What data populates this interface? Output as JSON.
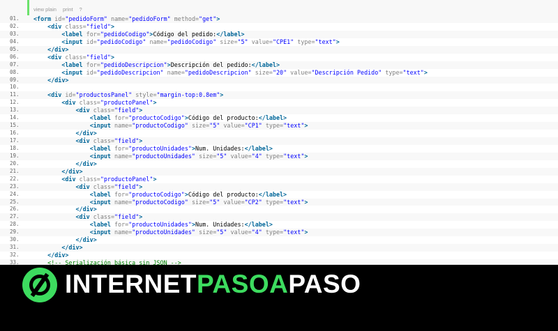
{
  "toolbar": {
    "view_plain": "view plain",
    "print": "print",
    "help": "?"
  },
  "code_lines": [
    {
      "n": "01.",
      "html": "<span class=\"tag\">&lt;form</span> <span class=\"attr\">id=</span><span class=\"val\">\"pedidoForm\"</span> <span class=\"attr\">name=</span><span class=\"val\">\"pedidoForm\"</span> <span class=\"attr\">method=</span><span class=\"val\">\"get\"</span><span class=\"tag\">&gt;</span>"
    },
    {
      "n": "02.",
      "html": "    <span class=\"tag\">&lt;div</span> <span class=\"attr\">class=</span><span class=\"val\">\"field\"</span><span class=\"tag\">&gt;</span>"
    },
    {
      "n": "03.",
      "html": "        <span class=\"tag\">&lt;label</span> <span class=\"attr\">for=</span><span class=\"val\">\"pedidoCodigo\"</span><span class=\"tag\">&gt;</span>Código del pedido:<span class=\"tag\">&lt;/label&gt;</span>"
    },
    {
      "n": "04.",
      "html": "        <span class=\"tag\">&lt;input</span> <span class=\"attr\">id=</span><span class=\"val\">\"pedidoCodigo\"</span> <span class=\"attr\">name=</span><span class=\"val\">\"pedidoCodigo\"</span> <span class=\"attr\">size=</span><span class=\"val\">\"5\"</span> <span class=\"attr\">value=</span><span class=\"val\">\"CPE1\"</span> <span class=\"attr\">type=</span><span class=\"val\">\"text\"</span><span class=\"tag\">&gt;</span>"
    },
    {
      "n": "05.",
      "html": "    <span class=\"tag\">&lt;/div&gt;</span>"
    },
    {
      "n": "06.",
      "html": "    <span class=\"tag\">&lt;div</span> <span class=\"attr\">class=</span><span class=\"val\">\"field\"</span><span class=\"tag\">&gt;</span>"
    },
    {
      "n": "07.",
      "html": "        <span class=\"tag\">&lt;label</span> <span class=\"attr\">for=</span><span class=\"val\">\"pedidoDescripcion\"</span><span class=\"tag\">&gt;</span>Descripción del pedido:<span class=\"tag\">&lt;/label&gt;</span>"
    },
    {
      "n": "08.",
      "html": "        <span class=\"tag\">&lt;input</span> <span class=\"attr\">id=</span><span class=\"val\">\"pedidoDescripcion\"</span> <span class=\"attr\">name=</span><span class=\"val\">\"pedidoDescripcion\"</span> <span class=\"attr\">size=</span><span class=\"val\">\"20\"</span> <span class=\"attr\">value=</span><span class=\"val\">\"Descripción Pedido\"</span> <span class=\"attr\">type=</span><span class=\"val\">\"text\"</span><span class=\"tag\">&gt;</span>"
    },
    {
      "n": "09.",
      "html": "    <span class=\"tag\">&lt;/div&gt;</span>"
    },
    {
      "n": "10.",
      "html": ""
    },
    {
      "n": "11.",
      "html": "    <span class=\"tag\">&lt;div</span> <span class=\"attr\">id=</span><span class=\"val\">\"productosPanel\"</span> <span class=\"attr\">style=</span><span class=\"val\">\"margin-top:0.8em\"</span><span class=\"tag\">&gt;</span>"
    },
    {
      "n": "12.",
      "html": "        <span class=\"tag\">&lt;div</span> <span class=\"attr\">class=</span><span class=\"val\">\"productoPanel\"</span><span class=\"tag\">&gt;</span>"
    },
    {
      "n": "13.",
      "html": "            <span class=\"tag\">&lt;div</span> <span class=\"attr\">class=</span><span class=\"val\">\"field\"</span><span class=\"tag\">&gt;</span>"
    },
    {
      "n": "14.",
      "html": "                <span class=\"tag\">&lt;label</span> <span class=\"attr\">for=</span><span class=\"val\">\"productoCodigo\"</span><span class=\"tag\">&gt;</span>Código del producto:<span class=\"tag\">&lt;/label&gt;</span>"
    },
    {
      "n": "15.",
      "html": "                <span class=\"tag\">&lt;input</span> <span class=\"attr\">name=</span><span class=\"val\">\"productoCodigo\"</span> <span class=\"attr\">size=</span><span class=\"val\">\"5\"</span> <span class=\"attr\">value=</span><span class=\"val\">\"CP1\"</span> <span class=\"attr\">type=</span><span class=\"val\">\"text\"</span><span class=\"tag\">&gt;</span>"
    },
    {
      "n": "16.",
      "html": "            <span class=\"tag\">&lt;/div&gt;</span>"
    },
    {
      "n": "17.",
      "html": "            <span class=\"tag\">&lt;div</span> <span class=\"attr\">class=</span><span class=\"val\">\"field\"</span><span class=\"tag\">&gt;</span>"
    },
    {
      "n": "18.",
      "html": "                <span class=\"tag\">&lt;label</span> <span class=\"attr\">for=</span><span class=\"val\">\"productoUnidades\"</span><span class=\"tag\">&gt;</span>Num. Unidades:<span class=\"tag\">&lt;/label&gt;</span>"
    },
    {
      "n": "19.",
      "html": "                <span class=\"tag\">&lt;input</span> <span class=\"attr\">name=</span><span class=\"val\">\"productoUnidades\"</span> <span class=\"attr\">size=</span><span class=\"val\">\"5\"</span> <span class=\"attr\">value=</span><span class=\"val\">\"4\"</span> <span class=\"attr\">type=</span><span class=\"val\">\"text\"</span><span class=\"tag\">&gt;</span>"
    },
    {
      "n": "20.",
      "html": "            <span class=\"tag\">&lt;/div&gt;</span>"
    },
    {
      "n": "21.",
      "html": "        <span class=\"tag\">&lt;/div&gt;</span>"
    },
    {
      "n": "22.",
      "html": "        <span class=\"tag\">&lt;div</span> <span class=\"attr\">class=</span><span class=\"val\">\"productoPanel\"</span><span class=\"tag\">&gt;</span>"
    },
    {
      "n": "23.",
      "html": "            <span class=\"tag\">&lt;div</span> <span class=\"attr\">class=</span><span class=\"val\">\"field\"</span><span class=\"tag\">&gt;</span>"
    },
    {
      "n": "24.",
      "html": "                <span class=\"tag\">&lt;label</span> <span class=\"attr\">for=</span><span class=\"val\">\"productoCodigo\"</span><span class=\"tag\">&gt;</span>Código del producto:<span class=\"tag\">&lt;/label&gt;</span>"
    },
    {
      "n": "25.",
      "html": "                <span class=\"tag\">&lt;input</span> <span class=\"attr\">name=</span><span class=\"val\">\"productoCodigo\"</span> <span class=\"attr\">size=</span><span class=\"val\">\"5\"</span> <span class=\"attr\">value=</span><span class=\"val\">\"CP2\"</span> <span class=\"attr\">type=</span><span class=\"val\">\"text\"</span><span class=\"tag\">&gt;</span>"
    },
    {
      "n": "26.",
      "html": "            <span class=\"tag\">&lt;/div&gt;</span>"
    },
    {
      "n": "27.",
      "html": "            <span class=\"tag\">&lt;div</span> <span class=\"attr\">class=</span><span class=\"val\">\"field\"</span><span class=\"tag\">&gt;</span>"
    },
    {
      "n": "28.",
      "html": "                <span class=\"tag\">&lt;label</span> <span class=\"attr\">for=</span><span class=\"val\">\"productoUnidades\"</span><span class=\"tag\">&gt;</span>Num. Unidades:<span class=\"tag\">&lt;/label&gt;</span>"
    },
    {
      "n": "29.",
      "html": "                <span class=\"tag\">&lt;input</span> <span class=\"attr\">name=</span><span class=\"val\">\"productoUnidades\"</span> <span class=\"attr\">size=</span><span class=\"val\">\"5\"</span> <span class=\"attr\">value=</span><span class=\"val\">\"4\"</span> <span class=\"attr\">type=</span><span class=\"val\">\"text\"</span><span class=\"tag\">&gt;</span>"
    },
    {
      "n": "30.",
      "html": "            <span class=\"tag\">&lt;/div&gt;</span>"
    },
    {
      "n": "31.",
      "html": "        <span class=\"tag\">&lt;/div&gt;</span>"
    },
    {
      "n": "32.",
      "html": "    <span class=\"tag\">&lt;/div&gt;</span>"
    },
    {
      "n": "33.",
      "html": "    <span class=\"cmt\">&lt;!-- Serialización básica sin JSON --&gt;</span>"
    }
  ],
  "banner": {
    "brand_white_1": "INTERNET",
    "brand_green": "PASOA",
    "brand_white_2": "PASO"
  },
  "colors": {
    "accent_green": "#3ddc5f",
    "gutter_bar": "#6ce26c"
  }
}
